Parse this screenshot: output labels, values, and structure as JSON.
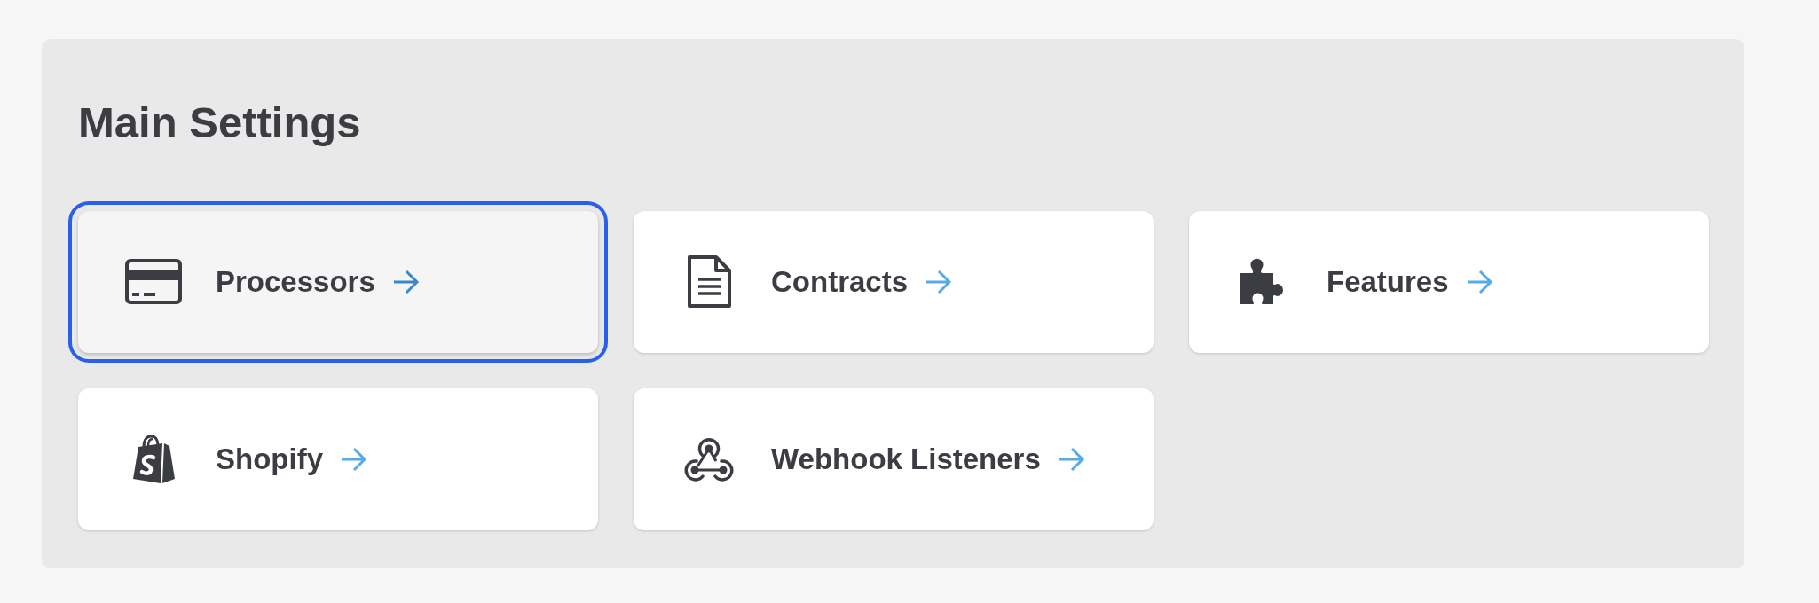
{
  "title": "Main Settings",
  "items": [
    {
      "label": "Processors",
      "focused": true
    },
    {
      "label": "Contracts",
      "focused": false
    },
    {
      "label": "Features",
      "focused": false
    },
    {
      "label": "Shopify",
      "focused": false
    },
    {
      "label": "Webhook Listeners",
      "focused": false
    }
  ]
}
